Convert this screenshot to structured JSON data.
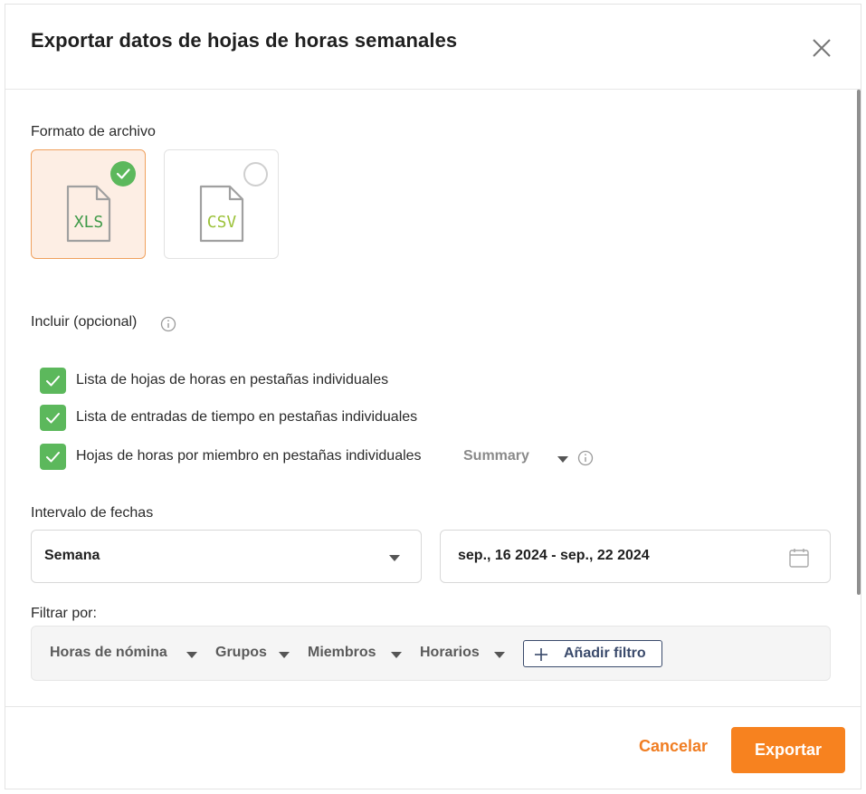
{
  "dialog": {
    "title": "Exportar datos de hojas de horas semanales",
    "close_icon": "close-icon"
  },
  "file_format": {
    "label": "Formato de archivo",
    "options": [
      {
        "label": "XLS",
        "selected": true,
        "icon": "xls-file-icon"
      },
      {
        "label": "CSV",
        "selected": false,
        "icon": "csv-file-icon"
      }
    ]
  },
  "include": {
    "label": "Incluir (opcional)",
    "options": [
      {
        "label": "Lista de hojas de horas en pestañas individuales",
        "checked": true
      },
      {
        "label": "Lista de entradas de tiempo en pestañas individuales",
        "checked": true
      },
      {
        "label": "Hojas de horas por miembro en pestañas individuales",
        "checked": true
      }
    ],
    "member_mode_value": "Summary"
  },
  "date_range": {
    "label": "Intervalo de fechas",
    "period_value": "Semana",
    "range_value": "sep., 16 2024 - sep., 22 2024"
  },
  "filters": {
    "label": "Filtrar por:",
    "items": [
      "Horas de nómina",
      "Grupos",
      "Miembros",
      "Horarios"
    ],
    "add_label": "Añadir filtro"
  },
  "footer": {
    "cancel_label": "Cancelar",
    "export_label": "Exportar"
  },
  "colors": {
    "accent": "#f7821f",
    "check_green": "#5cb85c",
    "selected_card_bg": "#fdeee4",
    "selected_card_border": "#f0a15e",
    "filter_button_border": "#3a4a6b"
  }
}
